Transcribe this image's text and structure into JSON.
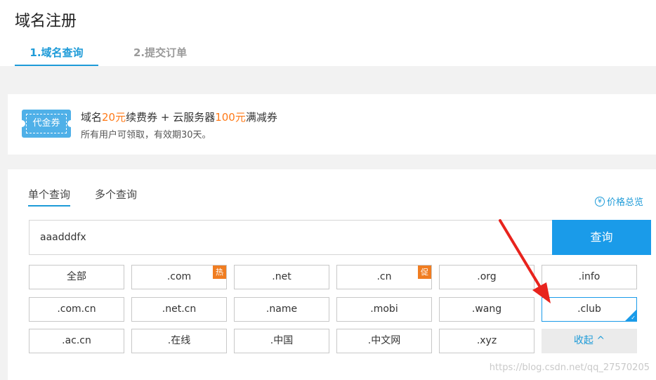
{
  "page_title": "域名注册",
  "steps": [
    "1.域名查询",
    "2.提交订单"
  ],
  "promo": {
    "ticket_label": "代金券",
    "line1_prefix": "域名",
    "line1_amount1": "20元",
    "line1_mid": "续费券 + 云服务器",
    "line1_amount2": "100元",
    "line1_suffix": "满减券",
    "line2": "所有用户可领取，有效期30天。"
  },
  "query_tabs": [
    "单个查询",
    "多个查询"
  ],
  "price_link": "价格总览",
  "search": {
    "value": "aaadddfx",
    "button": "查询"
  },
  "tlds": {
    "row1": [
      ".com",
      ".net",
      ".cn",
      ".org",
      ".info"
    ],
    "all": "全部",
    "row2": [
      ".com.cn",
      ".net.cn",
      ".name",
      ".mobi",
      ".wang",
      ".club"
    ],
    "row3": [
      ".ac.cn",
      ".在线",
      ".中国",
      ".中文网",
      ".xyz"
    ],
    "collapse": "收起 ^",
    "tag_hot": "热",
    "tag_promo": "促"
  },
  "watermark": "https://blog.csdn.net/qq_27570205",
  "colors": {
    "accent": "#1a9be9",
    "orange": "#ff7a18",
    "tag": "#f07d21",
    "arrow": "#e8231d"
  }
}
